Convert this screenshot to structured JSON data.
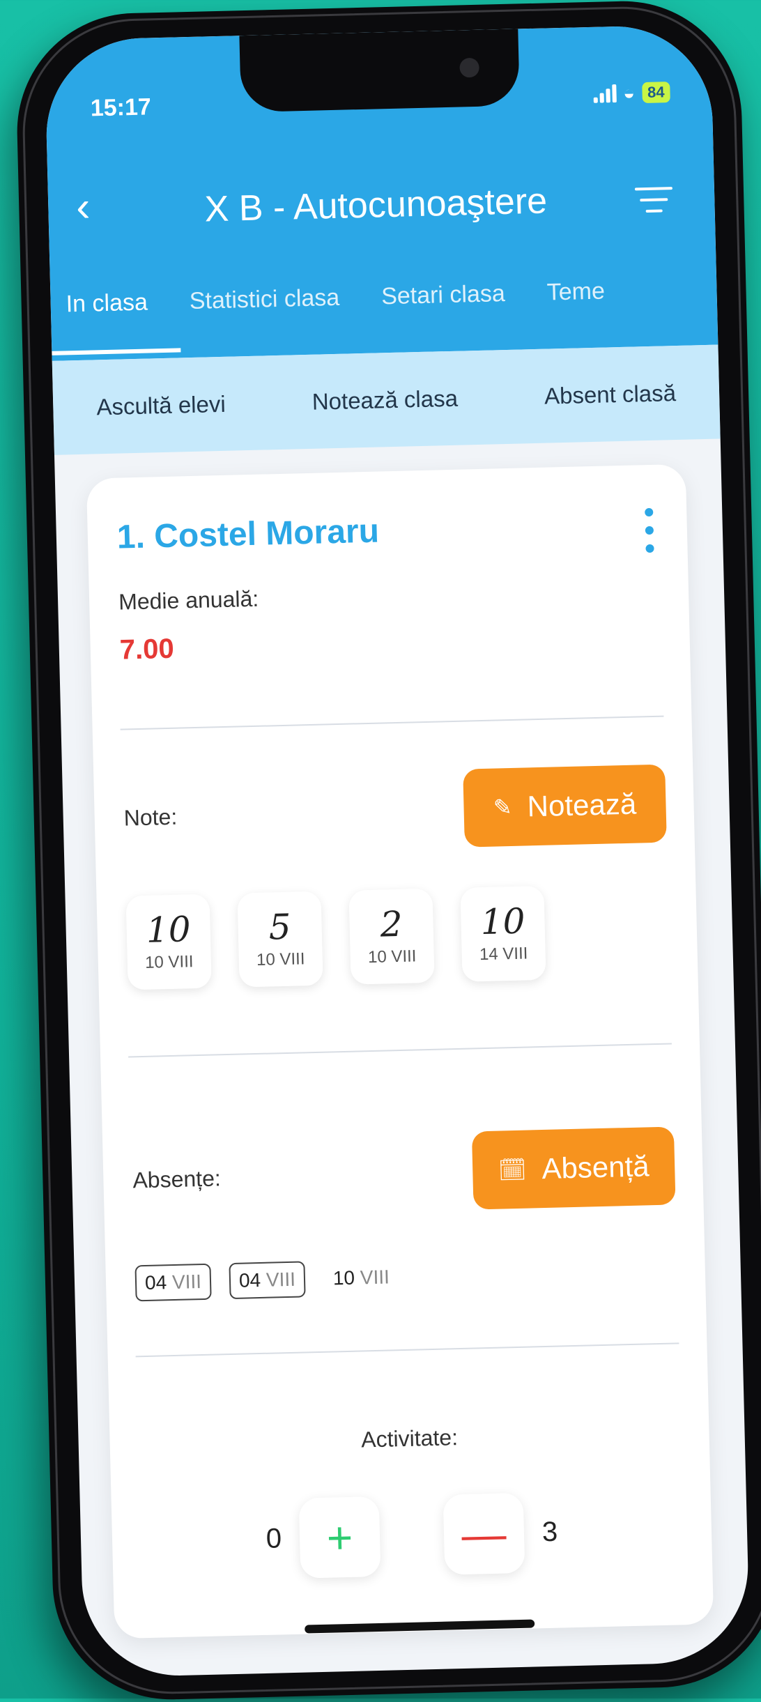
{
  "status_bar": {
    "time": "15:17",
    "battery": "84"
  },
  "header": {
    "title": "X B - Autocunoaştere"
  },
  "tabs": [
    {
      "label": "In clasa"
    },
    {
      "label": "Statistici clasa"
    },
    {
      "label": "Setari clasa"
    },
    {
      "label": "Teme"
    }
  ],
  "subtabs": [
    {
      "label": "Ascultă elevi"
    },
    {
      "label": "Notează clasa"
    },
    {
      "label": "Absent clasă"
    }
  ],
  "student": {
    "name": "1. Costel Moraru",
    "average_label": "Medie anuală:",
    "average_value": "7.00",
    "grades_label": "Note:",
    "grade_button": "Notează",
    "grades": [
      {
        "value": "10",
        "date": "10 VIII"
      },
      {
        "value": "5",
        "date": "10 VIII"
      },
      {
        "value": "2",
        "date": "10 VIII"
      },
      {
        "value": "10",
        "date": "14 VIII"
      }
    ],
    "absences_label": "Absențe:",
    "absence_button": "Absență",
    "absences": [
      {
        "day": "04",
        "month": "VIII"
      },
      {
        "day": "04",
        "month": "VIII"
      },
      {
        "day": "10",
        "month": "VIII"
      }
    ],
    "activity_label": "Activitate:",
    "activity_plus_count": "0",
    "activity_minus_count": "3"
  },
  "colors": {
    "accent": "#2ba7e6",
    "orange": "#f7931e",
    "average": "#e53935",
    "plus": "#2ecc71",
    "minus": "#e53935"
  }
}
